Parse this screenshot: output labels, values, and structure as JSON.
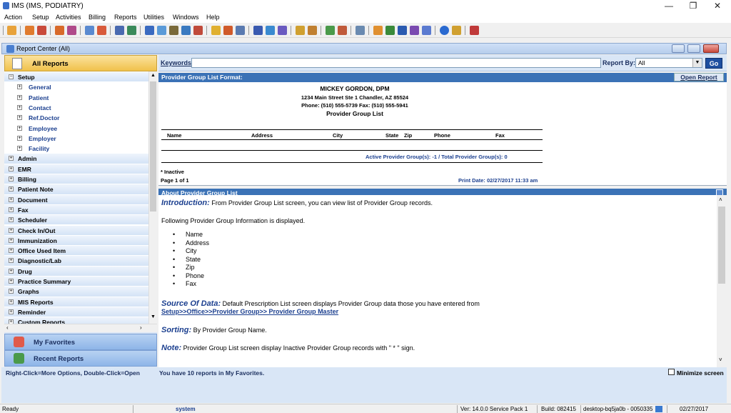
{
  "window": {
    "title": "IMS (IMS, PODIATRY)"
  },
  "menu": [
    "Action",
    "Setup",
    "Activities",
    "Billing",
    "Reports",
    "Utilities",
    "Windows",
    "Help"
  ],
  "report_center": {
    "title": "Report Center (All)"
  },
  "left": {
    "all_reports": "All Reports",
    "tree": [
      {
        "label": "Setup",
        "level": 0,
        "sign": "−"
      },
      {
        "label": "General",
        "level": 1,
        "sign": "+"
      },
      {
        "label": "Patient",
        "level": 1,
        "sign": "+"
      },
      {
        "label": "Contact",
        "level": 1,
        "sign": "+"
      },
      {
        "label": "Ref.Doctor",
        "level": 1,
        "sign": "+"
      },
      {
        "label": "Employee",
        "level": 1,
        "sign": "+"
      },
      {
        "label": "Employer",
        "level": 1,
        "sign": "+"
      },
      {
        "label": "Facility",
        "level": 1,
        "sign": "+"
      },
      {
        "label": "Admin",
        "level": 0,
        "sign": "+"
      },
      {
        "label": "EMR",
        "level": 0,
        "sign": "+"
      },
      {
        "label": "Billing",
        "level": 0,
        "sign": "+"
      },
      {
        "label": "Patient Note",
        "level": 0,
        "sign": "+"
      },
      {
        "label": "Document",
        "level": 0,
        "sign": "+"
      },
      {
        "label": "Fax",
        "level": 0,
        "sign": "+"
      },
      {
        "label": "Scheduler",
        "level": 0,
        "sign": "+"
      },
      {
        "label": "Check In/Out",
        "level": 0,
        "sign": "+"
      },
      {
        "label": "Immunization",
        "level": 0,
        "sign": "+"
      },
      {
        "label": "Office Used Item",
        "level": 0,
        "sign": "+"
      },
      {
        "label": "Diagnostic/Lab",
        "level": 0,
        "sign": "+"
      },
      {
        "label": "Drug",
        "level": 0,
        "sign": "+"
      },
      {
        "label": "Practice Summary",
        "level": 0,
        "sign": "+"
      },
      {
        "label": "Graphs",
        "level": 0,
        "sign": "+"
      },
      {
        "label": "MIS Reports",
        "level": 0,
        "sign": "+"
      },
      {
        "label": "Reminder",
        "level": 0,
        "sign": "+"
      },
      {
        "label": "Custom Reports",
        "level": 0,
        "sign": "+"
      }
    ],
    "my_favorites": "My Favorites",
    "recent_reports": "Recent Reports"
  },
  "search": {
    "keywords_label": "Keywords:",
    "keywords_value": "",
    "report_by_label": "Report By:",
    "report_by_value": "All",
    "go": "Go"
  },
  "format": {
    "header": "Provider Group List Format:",
    "open_report": "Open Report",
    "doctor": "MICKEY GORDON, DPM",
    "address": "1234 Main Street Ste 1   Chandler, AZ 85524",
    "phone": "Phone: (510) 555-5739  Fax: (510) 555-5941",
    "report_title": "Provider Group List",
    "columns": [
      "Name",
      "Address",
      "City",
      "State",
      "Zip",
      "Phone",
      "Fax"
    ],
    "summary": "Active Provider Group(s): -1 / Total Provider Group(s): 0",
    "inactive_note": "* Inactive",
    "page": "Page 1 of 1",
    "print_date": "Print Date: 02/27/2017 11:33 am"
  },
  "about": {
    "header": "About Provider Group List",
    "intro_label": "Introduction:",
    "intro_text": " From Provider Group List screen, you can view list of Provider Group records.",
    "following": "Following Provider Group Information is displayed.",
    "fields": [
      "Name",
      "Address",
      "City",
      "State",
      "Zip",
      "Phone",
      "Fax"
    ],
    "source_label": "Source Of Data:",
    "source_text": " Default Prescription List screen displays Provider Group data those you have entered from",
    "source_link": "Setup>>Office>>Provider Group>> Provider Group Master",
    "sorting_label": "Sorting:",
    "sorting_text": " By Provider Group Name.",
    "note_label": "Note:",
    "note_text": " Provider Group List screen display Inactive Provider Group records with \" * \" sign."
  },
  "hint": {
    "left": "Right-Click=More Options, Double-Click=Open",
    "favorites": "You have 10 reports in My Favorites.",
    "minimize": "Minimize screen"
  },
  "status": {
    "ready": "Ready",
    "user": "system",
    "version": "Ver: 14.0.0 Service Pack 1",
    "build": "Build: 082415",
    "machine": "desktop-bq5ja0b - 0050335",
    "date": "02/27/2017"
  }
}
